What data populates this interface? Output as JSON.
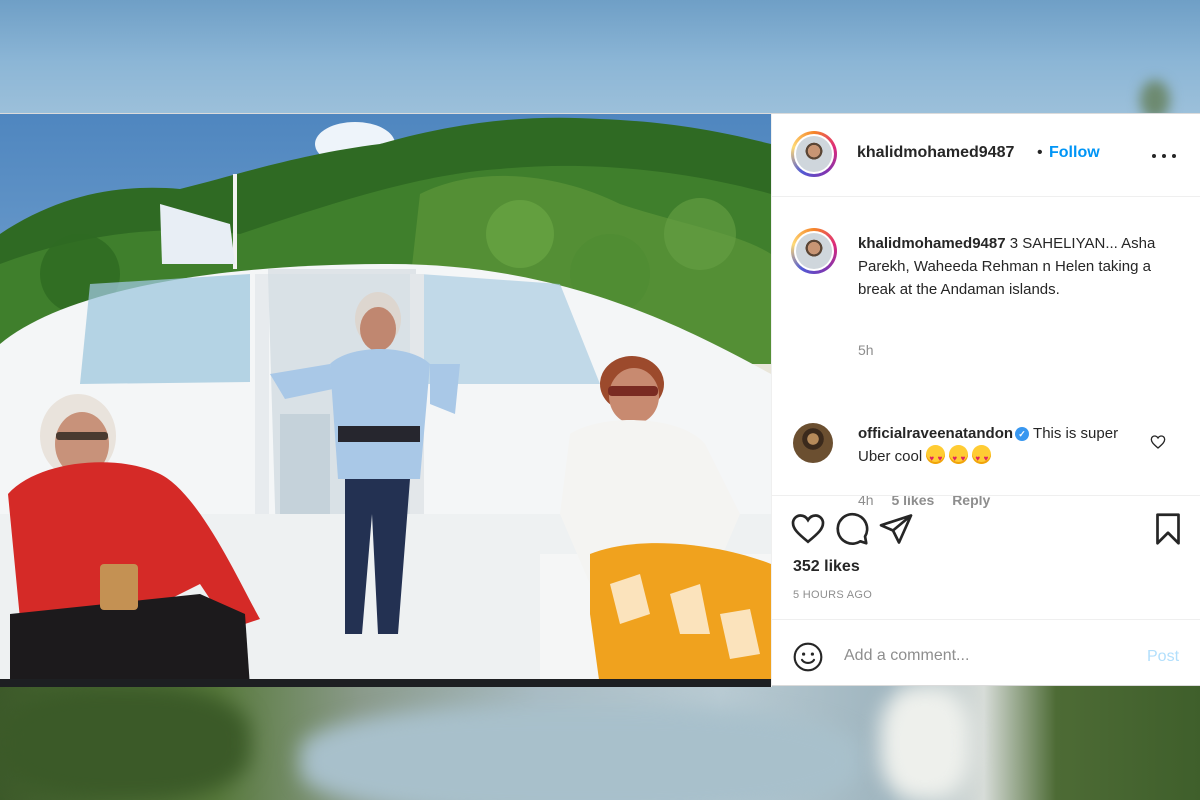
{
  "post": {
    "username": "khalidmohamed9487",
    "separator": "•",
    "follow_label": "Follow",
    "caption_username": "khalidmohamed9487",
    "caption_text": "3 SAHELIYAN... Asha Parekh, Waheeda Rehman n Helen taking a break at the Andaman islands.",
    "caption_time": "5h",
    "likes": "352 likes",
    "time_ago": "5 HOURS AGO"
  },
  "comment": {
    "username": "officialraveenatandon",
    "text": "This is super Uber cool",
    "emoji_count": 3,
    "time": "4h",
    "likes": "5 likes",
    "reply_label": "Reply"
  },
  "add_comment": {
    "placeholder": "Add a comment...",
    "post_label": "Post"
  },
  "icons": {
    "more": "more-options-icon",
    "heart": "heart-icon",
    "comment": "comment-icon",
    "share": "share-icon",
    "save": "bookmark-icon",
    "emoji": "smiley-icon",
    "verified": "verified-badge-icon"
  },
  "colors": {
    "link_blue": "#0095f6",
    "post_disabled": "#b2dffc",
    "muted": "#8e8e8e",
    "verified": "#3897f0"
  }
}
